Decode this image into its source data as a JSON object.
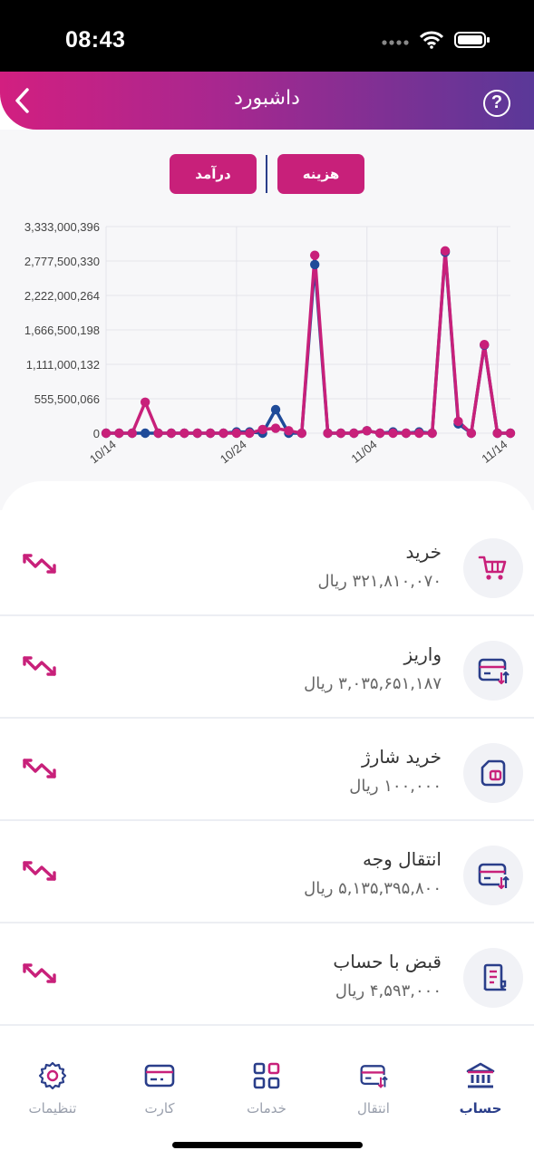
{
  "status": {
    "time": "08:43"
  },
  "header": {
    "title": "داشبورد",
    "help_label": "?"
  },
  "toggles": {
    "expense_label": "هزینه",
    "income_label": "درآمد"
  },
  "colors": {
    "expense": "#c8207a",
    "income": "#1f4b99",
    "brand_dark": "#2a3e8a"
  },
  "chart_data": {
    "type": "line",
    "y_ticks": [
      "3,333,000,396",
      "2,777,500,330",
      "2,222,000,264",
      "1,666,500,198",
      "1,111,000,132",
      "555,500,066",
      "0"
    ],
    "ylim": [
      0,
      3333000396
    ],
    "x_tick_labels": [
      {
        "label": "10/14",
        "index": 0
      },
      {
        "label": "10/24",
        "index": 10
      },
      {
        "label": "11/04",
        "index": 20
      },
      {
        "label": "11/14",
        "index": 30
      }
    ],
    "series": [
      {
        "key": "income",
        "color": "#1f4b99",
        "values": [
          0,
          0,
          0,
          0,
          0,
          0,
          0,
          0,
          0,
          0,
          20000000,
          20000000,
          0,
          380000000,
          0,
          0,
          2720000000,
          0,
          0,
          0,
          40000000,
          0,
          20000000,
          0,
          20000000,
          0,
          2920000000,
          150000000,
          0,
          1420000000,
          0,
          0
        ]
      },
      {
        "key": "expense",
        "color": "#c8207a",
        "values": [
          0,
          0,
          0,
          500000000,
          0,
          0,
          0,
          0,
          0,
          0,
          0,
          0,
          60000000,
          80000000,
          40000000,
          0,
          2870000000,
          0,
          0,
          0,
          40000000,
          0,
          0,
          0,
          0,
          0,
          2940000000,
          190000000,
          0,
          1430000000,
          0,
          0
        ]
      }
    ]
  },
  "list": [
    {
      "title": "خرید",
      "amount": "۳۲۱,۸۱۰,۰۷۰ ریال",
      "icon": "cart-icon"
    },
    {
      "title": "واریز",
      "amount": "۳,۰۳۵,۶۵۱,۱۸۷ ریال",
      "icon": "card-transfer-icon"
    },
    {
      "title": "خرید شارژ",
      "amount": "۱۰۰,۰۰۰ ریال",
      "icon": "sim-card-icon"
    },
    {
      "title": "انتقال وجه",
      "amount": "۵,۱۳۵,۳۹۵,۸۰۰ ریال",
      "icon": "card-transfer-icon"
    },
    {
      "title": "قبض با حساب",
      "amount": "۴,۵۹۳,۰۰۰ ریال",
      "icon": "bill-icon"
    }
  ],
  "bottom_nav": [
    {
      "label": "حساب",
      "icon": "bank-icon",
      "active": true
    },
    {
      "label": "انتقال",
      "icon": "transfer-icon",
      "active": false
    },
    {
      "label": "خدمات",
      "icon": "grid-icon",
      "active": false
    },
    {
      "label": "کارت",
      "icon": "card-icon",
      "active": false
    },
    {
      "label": "تنظیمات",
      "icon": "gear-icon",
      "active": false
    }
  ]
}
